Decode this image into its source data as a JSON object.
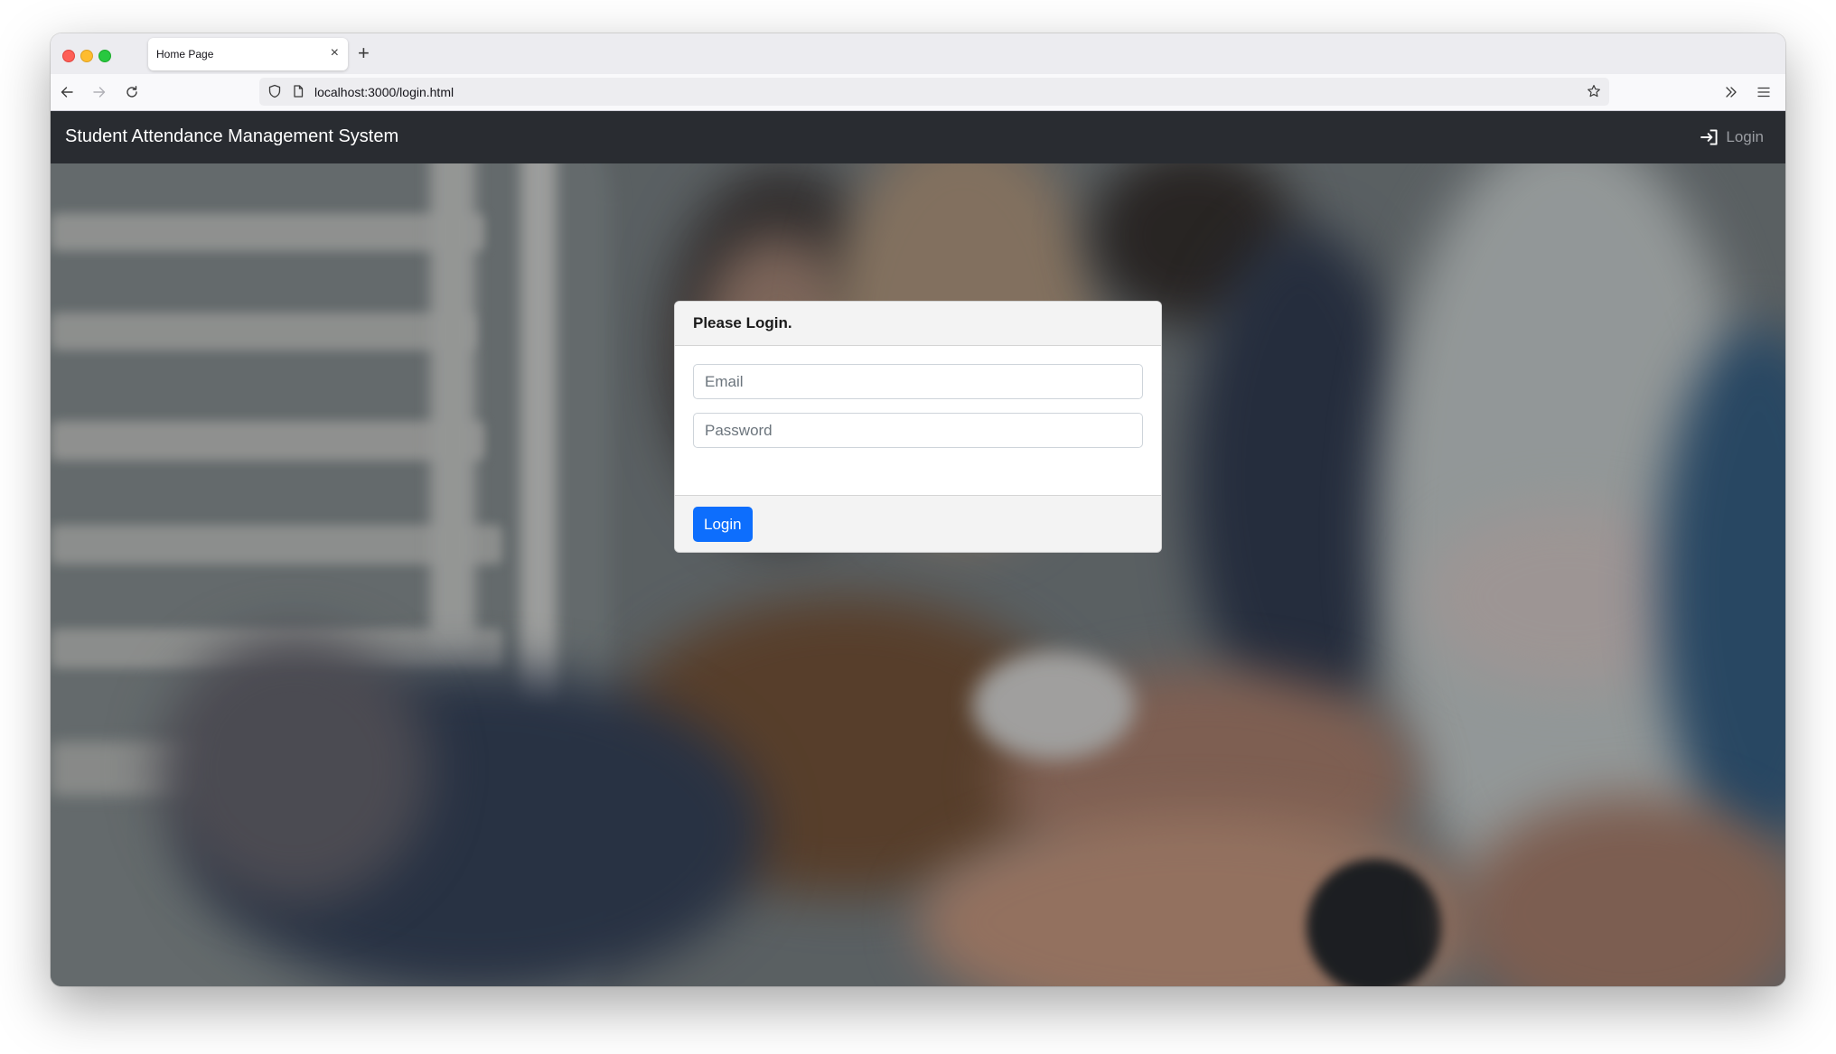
{
  "browser": {
    "tab_title": "Home Page",
    "url": "localhost:3000/login.html",
    "icons": {
      "close": "close-icon",
      "new_tab": "plus-icon",
      "back": "arrow-left-icon",
      "forward": "arrow-right-icon",
      "reload": "reload-icon",
      "tracking": "shield-icon",
      "page": "page-icon",
      "bookmark": "star-icon",
      "overflow": "chevrons-right-icon",
      "menu": "hamburger-menu-icon"
    },
    "close_glyph": "×",
    "new_tab_glyph": "+"
  },
  "navbar": {
    "brand": "Student Attendance Management System",
    "login_label": "Login",
    "login_icon": "box-arrow-in-right-icon",
    "background": "#292c31"
  },
  "login_card": {
    "title": "Please Login.",
    "email": {
      "value": "",
      "placeholder": "Email"
    },
    "password": {
      "value": "",
      "placeholder": "Password"
    },
    "submit_label": "Login",
    "accent": "#0d6efd"
  }
}
